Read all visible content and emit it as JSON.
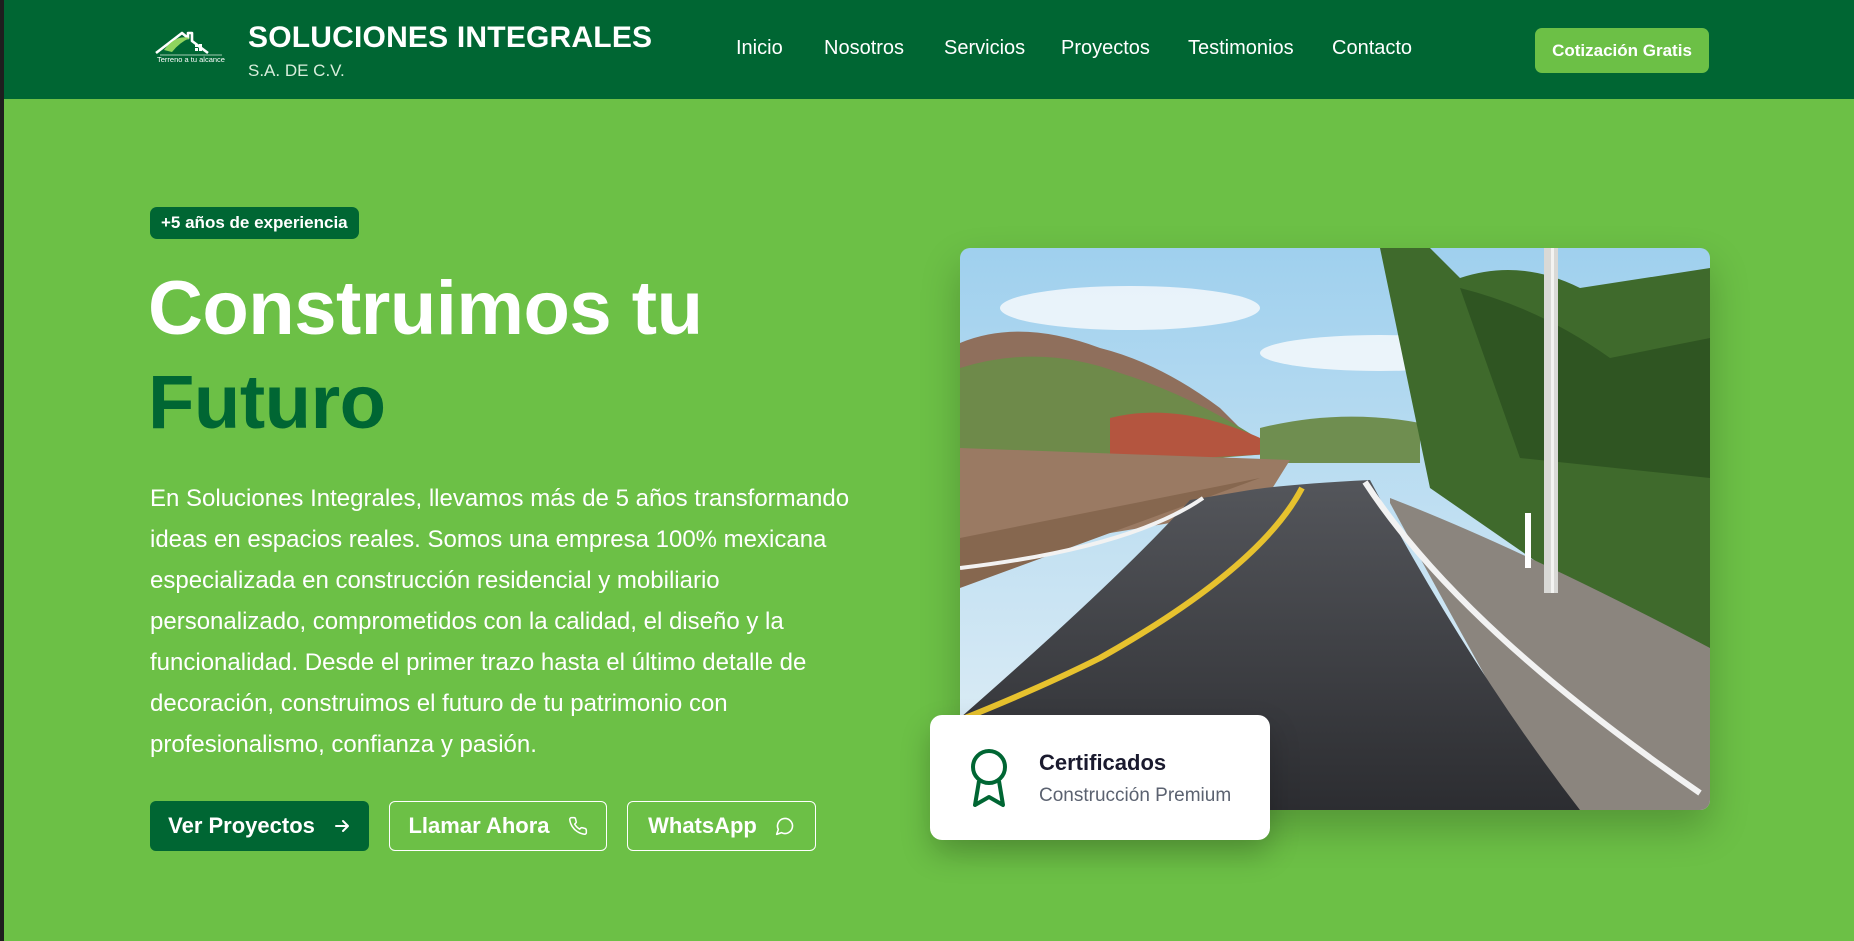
{
  "colors": {
    "header_bg": "#006633",
    "accent_green": "#6cc046",
    "dark_green": "#006633",
    "white": "#ffffff"
  },
  "header": {
    "logo_icon": "house-roof-logo",
    "logo_caption": "Terreno a tu alcance",
    "brand_name": "SOLUCIONES INTEGRALES",
    "brand_sub": "S.A. DE C.V.",
    "nav": [
      "Inicio",
      "Nosotros",
      "Servicios",
      "Proyectos",
      "Testimonios",
      "Contacto"
    ],
    "cta_label": "Cotización Gratis"
  },
  "hero": {
    "badge": "+5 años de experiencia",
    "title_line1": "Construimos tu",
    "title_line2": "Futuro",
    "description": "En Soluciones Integrales, llevamos más de 5 años transformando ideas en espacios reales. Somos una empresa 100% mexicana especializada en construcción residencial y mobiliario personalizado, comprometidos con la calidad, el diseño y la funcionalidad. Desde el primer trazo hasta el último detalle de decoración, construimos el futuro de tu patrimonio con profesionalismo, confianza y pasión.",
    "buttons": {
      "projects": "Ver Proyectos",
      "call": "Llamar Ahora",
      "whatsapp": "WhatsApp"
    },
    "icons": {
      "projects": "arrow-right-icon",
      "call": "phone-icon",
      "whatsapp": "chat-bubble-icon"
    }
  },
  "media": {
    "photo": "paved-rural-road-photo"
  },
  "certificate": {
    "icon": "award-ribbon-icon",
    "title": "Certificados",
    "subtitle": "Construcción Premium"
  }
}
